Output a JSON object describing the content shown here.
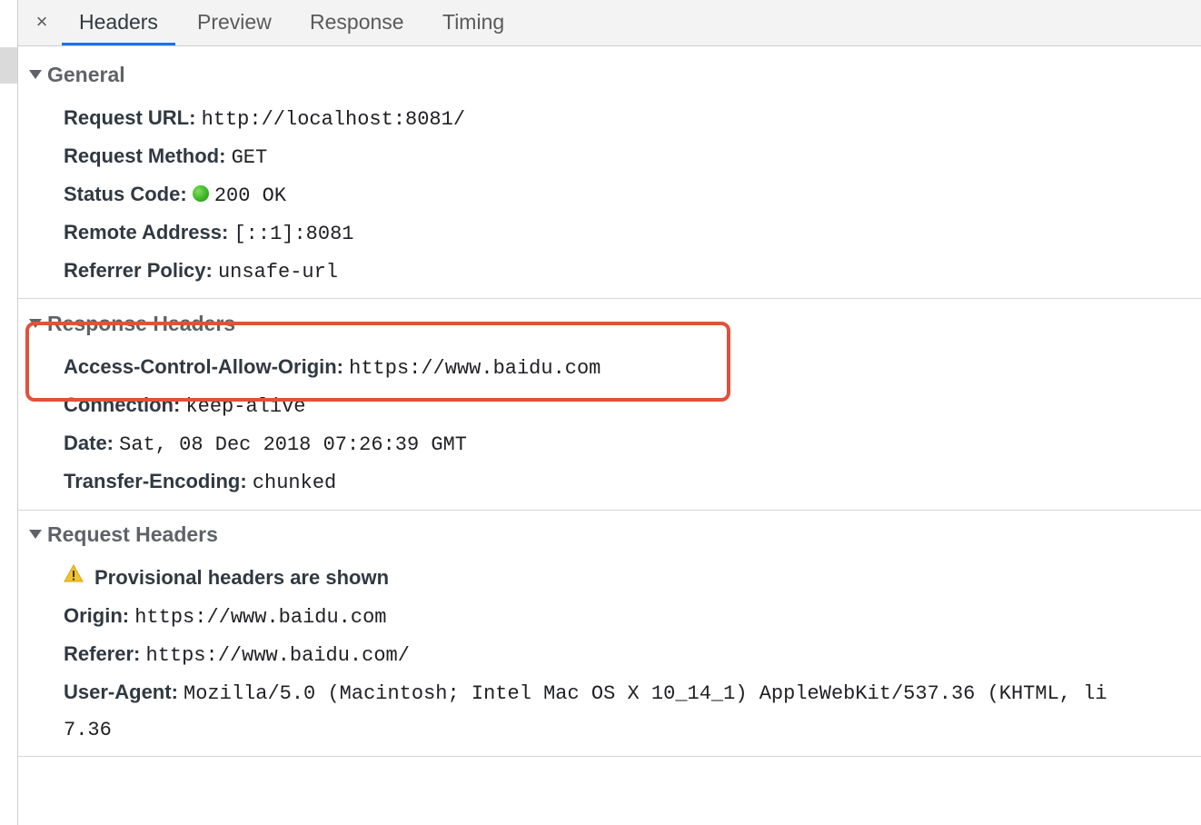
{
  "tabs": {
    "close_glyph": "×",
    "items": [
      {
        "label": "Headers",
        "active": true
      },
      {
        "label": "Preview"
      },
      {
        "label": "Response"
      },
      {
        "label": "Timing"
      }
    ]
  },
  "general": {
    "title": "General",
    "rows": [
      {
        "key": "Request URL:",
        "value": "http://localhost:8081/"
      },
      {
        "key": "Request Method:",
        "value": "GET"
      },
      {
        "key": "Status Code:",
        "value": "200 OK"
      },
      {
        "key": "Remote Address:",
        "value": "[::1]:8081"
      },
      {
        "key": "Referrer Policy:",
        "value": "unsafe-url"
      }
    ]
  },
  "response_headers": {
    "title": "Response Headers",
    "rows": [
      {
        "key": "Access-Control-Allow-Origin:",
        "value": "https://www.baidu.com"
      },
      {
        "key": "Connection:",
        "value": "keep-alive"
      },
      {
        "key": "Date:",
        "value": "Sat, 08 Dec 2018 07:26:39 GMT"
      },
      {
        "key": "Transfer-Encoding:",
        "value": "chunked"
      }
    ]
  },
  "request_headers": {
    "title": "Request Headers",
    "warning": "Provisional headers are shown",
    "rows": [
      {
        "key": "Origin:",
        "value": "https://www.baidu.com"
      },
      {
        "key": "Referer:",
        "value": "https://www.baidu.com/"
      },
      {
        "key": "User-Agent:",
        "value": "Mozilla/5.0 (Macintosh; Intel Mac OS X 10_14_1) AppleWebKit/537.36 (KHTML, li",
        "continuation": "7.36"
      }
    ]
  },
  "colors": {
    "accent": "#1a73e8",
    "highlight_border": "#e4503a",
    "status_ok": "#2fa81a",
    "warning": "#f2c12e"
  },
  "icons": {
    "close": "close-icon",
    "section_toggle": "triangle-down-icon",
    "status": "green-dot-icon",
    "warning": "warning-triangle-icon"
  }
}
